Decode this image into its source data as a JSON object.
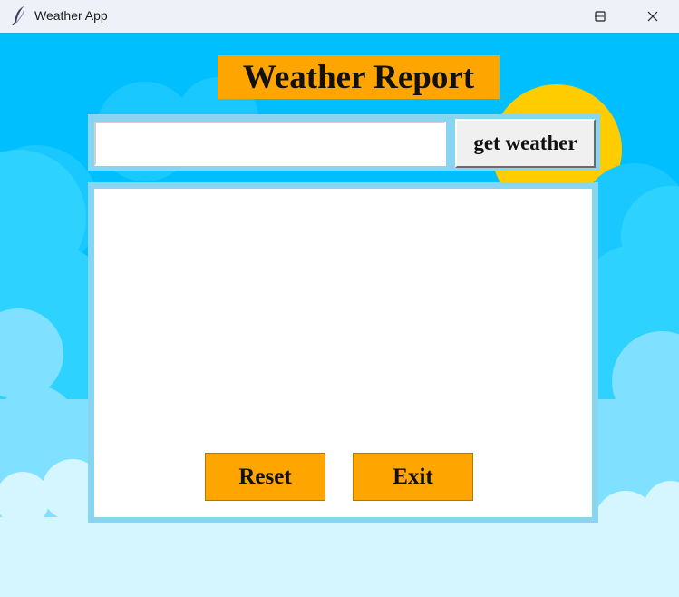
{
  "window": {
    "title": "Weather App",
    "app_icon": "feather-icon",
    "controls": [
      "minimize-icon",
      "maximize-icon",
      "close-icon"
    ]
  },
  "header": {
    "title": "Weather Report"
  },
  "search": {
    "value": "",
    "placeholder": "",
    "button_label": "get weather"
  },
  "result": {
    "text": ""
  },
  "actions": {
    "reset_label": "Reset",
    "exit_label": "Exit"
  },
  "colors": {
    "accent": "#ffa500",
    "sky": "#00bfff",
    "sun": "#ffcc00",
    "frame": "#87d5f0",
    "titlebar": "#eef1f8"
  }
}
